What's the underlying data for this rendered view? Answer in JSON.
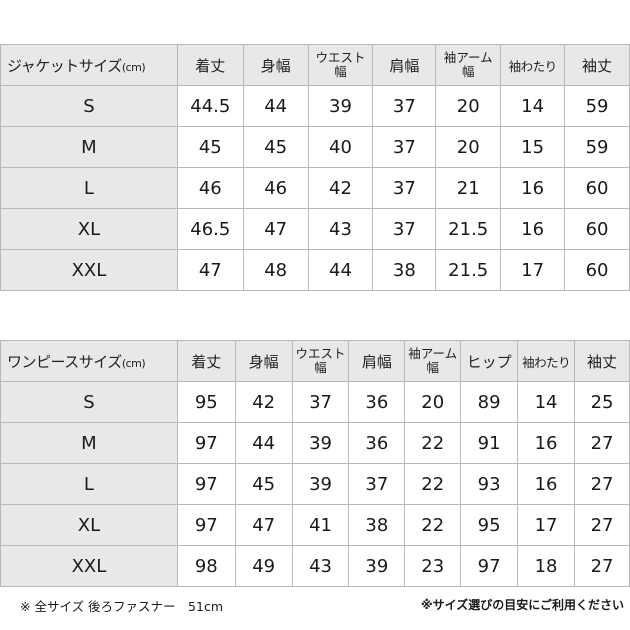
{
  "jacket": {
    "header_label": "ジャケットサイズ",
    "unit": "(cm)",
    "columns": [
      "着丈",
      "身幅",
      "ウエスト幅",
      "肩幅",
      "袖アーム幅",
      "袖わたり",
      "袖丈"
    ],
    "rows": [
      {
        "size": "S",
        "values": [
          "44.5",
          "44",
          "39",
          "37",
          "20",
          "14",
          "59"
        ]
      },
      {
        "size": "M",
        "values": [
          "45",
          "45",
          "40",
          "37",
          "20",
          "15",
          "59"
        ]
      },
      {
        "size": "L",
        "values": [
          "46",
          "46",
          "42",
          "37",
          "21",
          "16",
          "60"
        ]
      },
      {
        "size": "XL",
        "values": [
          "46.5",
          "47",
          "43",
          "37",
          "21.5",
          "16",
          "60"
        ]
      },
      {
        "size": "XXL",
        "values": [
          "47",
          "48",
          "44",
          "38",
          "21.5",
          "17",
          "60"
        ]
      }
    ]
  },
  "onepiece": {
    "header_label": "ワンピースサイズ",
    "unit": "(cm)",
    "columns": [
      "着丈",
      "身幅",
      "ウエスト幅",
      "肩幅",
      "袖アーム幅",
      "ヒップ",
      "袖わたり",
      "袖丈"
    ],
    "rows": [
      {
        "size": "S",
        "values": [
          "95",
          "42",
          "37",
          "36",
          "20",
          "89",
          "14",
          "25"
        ]
      },
      {
        "size": "M",
        "values": [
          "97",
          "44",
          "39",
          "36",
          "22",
          "91",
          "16",
          "27"
        ]
      },
      {
        "size": "L",
        "values": [
          "97",
          "45",
          "39",
          "37",
          "22",
          "93",
          "16",
          "27"
        ]
      },
      {
        "size": "XL",
        "values": [
          "97",
          "47",
          "41",
          "38",
          "22",
          "95",
          "17",
          "27"
        ]
      },
      {
        "size": "XXL",
        "values": [
          "98",
          "49",
          "43",
          "39",
          "23",
          "97",
          "18",
          "27"
        ]
      }
    ]
  },
  "notes": {
    "zipper": "※ 全サイズ 後ろファスナー　51cm",
    "guide": "※サイズ選びの目安にご利用ください"
  },
  "colors": {
    "header_bg": "#e8e8e8",
    "border": "#b8b8b8",
    "text": "#1a1a1a"
  }
}
